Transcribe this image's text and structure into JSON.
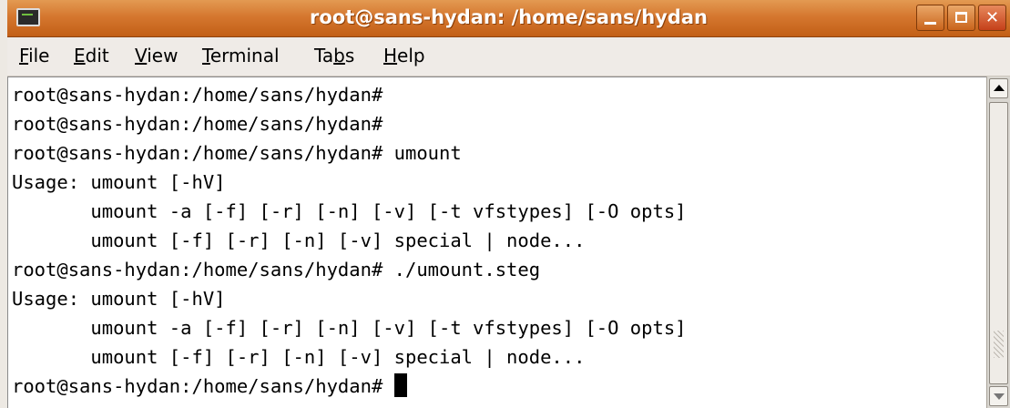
{
  "window": {
    "title": "root@sans-hydan: /home/sans/hydan"
  },
  "menu": [
    {
      "pre": "",
      "key": "F",
      "post": "ile"
    },
    {
      "pre": "",
      "key": "E",
      "post": "dit"
    },
    {
      "pre": "",
      "key": "V",
      "post": "iew"
    },
    {
      "pre": "",
      "key": "T",
      "post": "erminal"
    },
    {
      "pre": "Ta",
      "key": "b",
      "post": "s"
    },
    {
      "pre": "",
      "key": "H",
      "post": "elp"
    }
  ],
  "terminal": {
    "lines": [
      "root@sans-hydan:/home/sans/hydan#",
      "root@sans-hydan:/home/sans/hydan#",
      "root@sans-hydan:/home/sans/hydan# umount",
      "Usage: umount [-hV]",
      "       umount -a [-f] [-r] [-n] [-v] [-t vfstypes] [-O opts]",
      "       umount [-f] [-r] [-n] [-v] special | node...",
      "root@sans-hydan:/home/sans/hydan# ./umount.steg",
      "Usage: umount [-hV]",
      "       umount -a [-f] [-r] [-n] [-v] [-t vfstypes] [-O opts]",
      "       umount [-f] [-r] [-n] [-v] special | node...",
      "root@sans-hydan:/home/sans/hydan# "
    ]
  },
  "colors": {
    "titlebar": "#d5772f",
    "terminal_bg": "#ffffff",
    "terminal_fg": "#000000"
  },
  "icons": {
    "window": "terminal-icon",
    "minimize": "minimize-icon",
    "maximize": "maximize-icon",
    "close": "close-icon"
  }
}
